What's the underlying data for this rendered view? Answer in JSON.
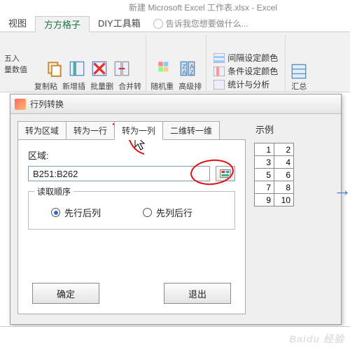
{
  "app": {
    "title": "新建 Microsoft Excel 工作表.xlsx - Excel"
  },
  "menu": {
    "tab_view": "视图",
    "tab_ffgz": "方方格子",
    "tab_diy": "DIY工具箱",
    "tellme": "告诉我您想要做什么..."
  },
  "ribbon": {
    "left1": "五入",
    "left2": "量数值",
    "btn_copy": "复制粘",
    "btn_newadd": "新增插",
    "btn_batchdel": "批量删",
    "btn_merge": "合并转",
    "btn_random": "随机重",
    "btn_advsort": "高级排",
    "cond_interval": "间隔设定颜色",
    "cond_cond": "条件设定颜色",
    "cond_stats": "统计与分析",
    "btn_summary": "汇总"
  },
  "dialog": {
    "title": "行列转换",
    "tabs": {
      "region": "转为区域",
      "row": "转为一行",
      "col": "转为一列",
      "twod": "二维转一维"
    },
    "field_region": "区域:",
    "region_value": "B251:B262",
    "group_order": "读取顺序",
    "radio_rowcol": "先行后列",
    "radio_colrow": "先列后行",
    "btn_ok": "确定",
    "btn_cancel": "退出",
    "example_label": "示例"
  },
  "example_table": [
    [
      1,
      2
    ],
    [
      3,
      4
    ],
    [
      5,
      6
    ],
    [
      7,
      8
    ],
    [
      9,
      10
    ]
  ],
  "watermark": "Baidu 经验"
}
